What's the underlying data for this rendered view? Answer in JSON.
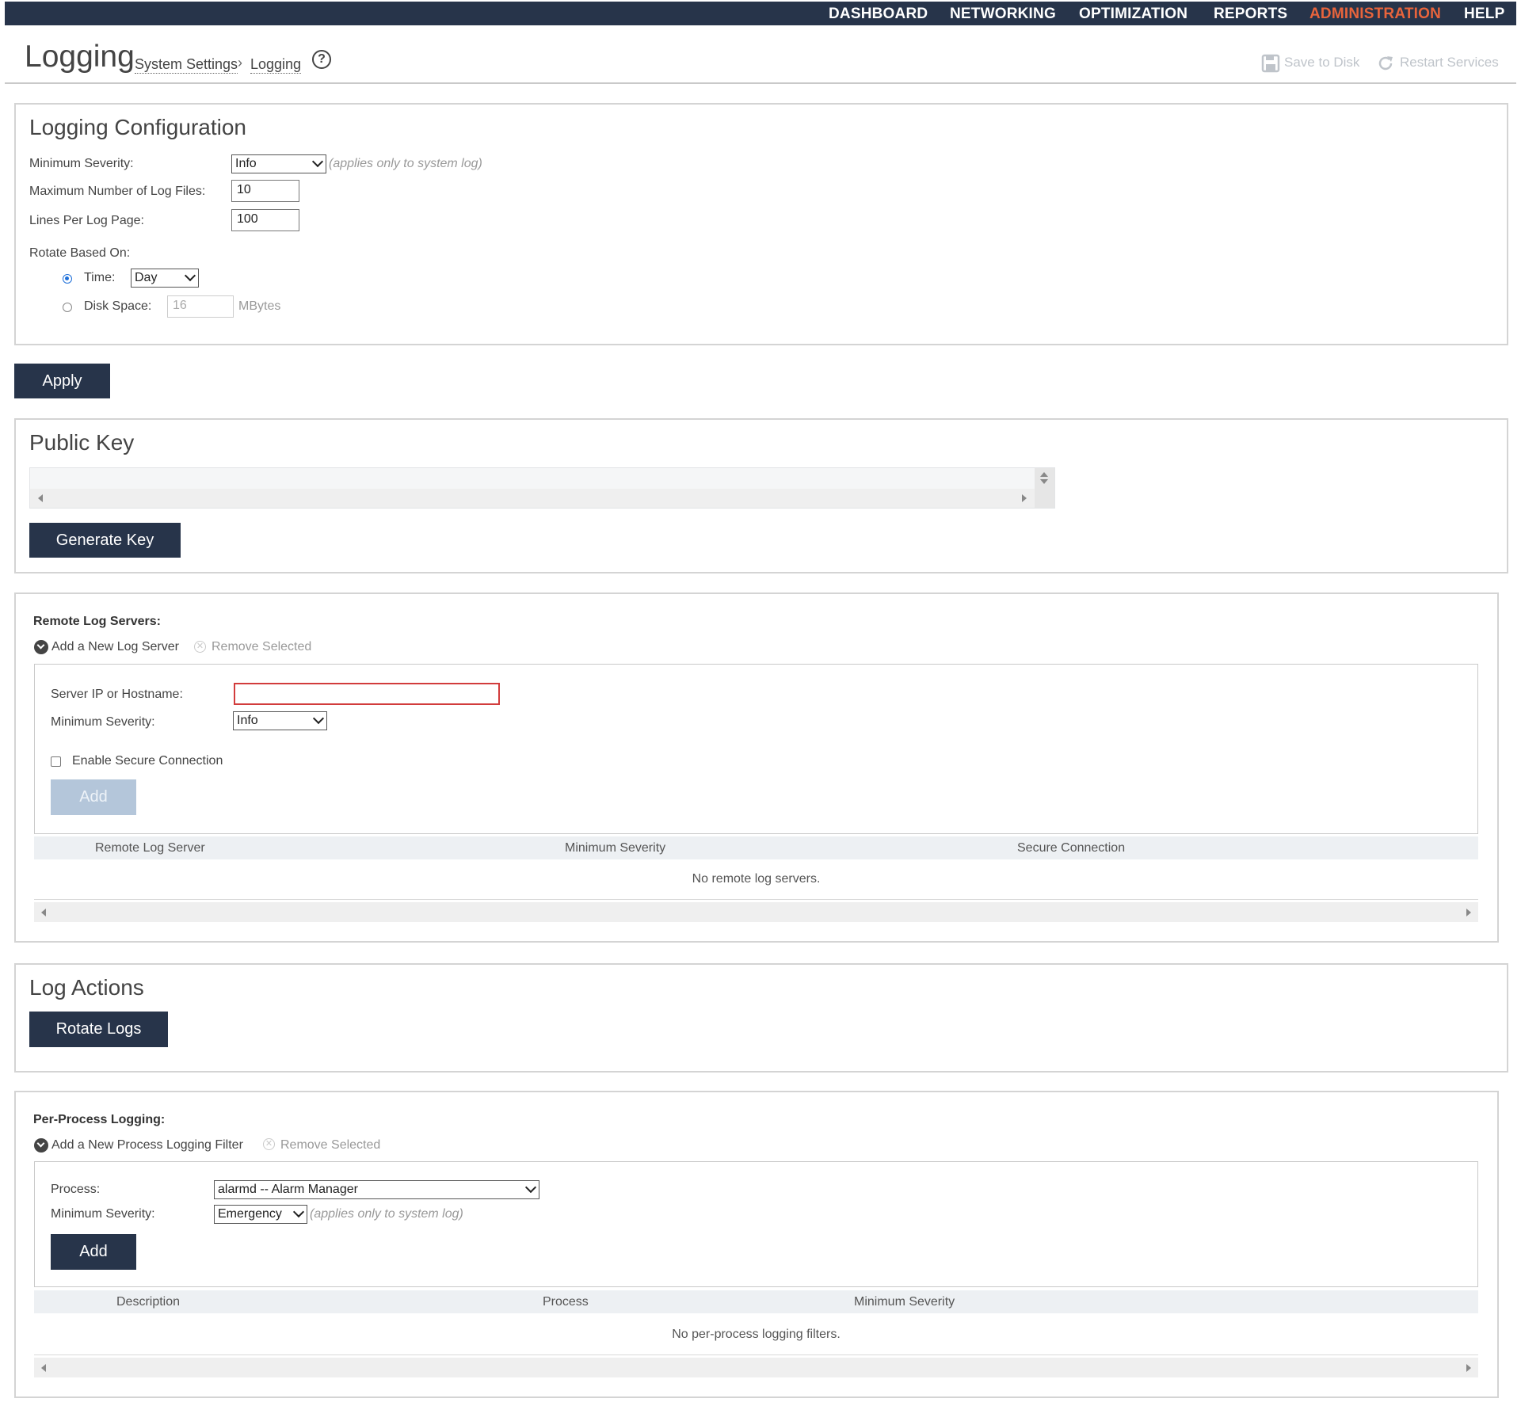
{
  "nav": {
    "items": [
      "DASHBOARD",
      "NETWORKING",
      "OPTIMIZATION",
      "REPORTS",
      "ADMINISTRATION",
      "HELP"
    ],
    "active": "ADMINISTRATION",
    "active_color": "#e8643c",
    "bar_color": "#27344a"
  },
  "header": {
    "title": "Logging",
    "breadcrumb": [
      "System Settings",
      "Logging"
    ],
    "breadcrumb_separator": "›",
    "help_icon": "help-circle-icon",
    "save_label": "Save to Disk",
    "restart_label": "Restart Services"
  },
  "logging_config": {
    "title": "Logging Configuration",
    "min_severity_label": "Minimum Severity:",
    "min_severity_value": "Info",
    "min_severity_hint": "(applies only to system log)",
    "max_files_label": "Maximum Number of Log Files:",
    "max_files_value": "10",
    "lines_per_page_label": "Lines Per Log Page:",
    "lines_per_page_value": "100",
    "rotate_label": "Rotate Based On:",
    "time_label": "Time:",
    "time_value": "Day",
    "disk_label": "Disk Space:",
    "disk_value": "16",
    "disk_unit": "MBytes",
    "apply_label": "Apply"
  },
  "public_key": {
    "title": "Public Key",
    "generate_label": "Generate Key"
  },
  "remote_servers": {
    "title": "Remote Log Servers:",
    "add_link": "Add a New Log Server",
    "remove_link": "Remove Selected",
    "host_label": "Server IP or Hostname:",
    "host_value": "",
    "severity_label": "Minimum Severity:",
    "severity_value": "Info",
    "secure_label": "Enable Secure Connection",
    "add_label": "Add",
    "columns": [
      "Remote Log Server",
      "Minimum Severity",
      "Secure Connection"
    ],
    "empty_message": "No remote log servers."
  },
  "log_actions": {
    "title": "Log Actions",
    "rotate_label": "Rotate Logs"
  },
  "per_process": {
    "title": "Per-Process Logging:",
    "add_link": "Add a New Process Logging Filter",
    "remove_link": "Remove Selected",
    "process_label": "Process:",
    "process_value": "alarmd -- Alarm Manager",
    "severity_label": "Minimum Severity:",
    "severity_value": "Emergency",
    "severity_hint": "(applies only to system log)",
    "add_label": "Add",
    "columns": [
      "Description",
      "Process",
      "Minimum Severity"
    ],
    "empty_message": "No per-process logging filters."
  }
}
